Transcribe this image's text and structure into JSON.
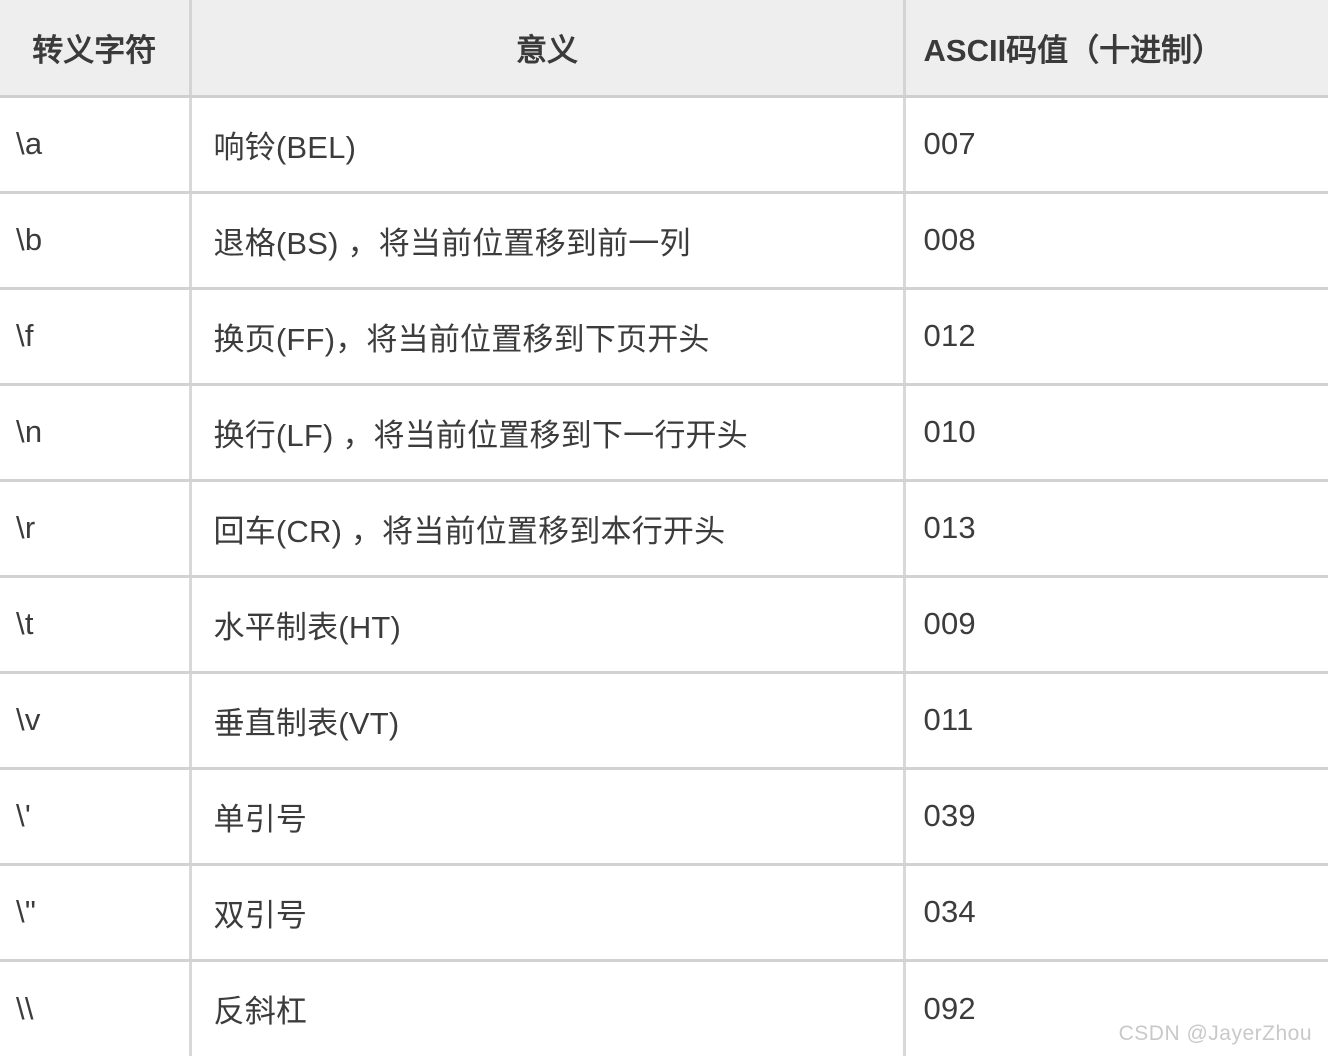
{
  "table": {
    "columns": [
      "转义字符",
      "意义",
      "ASCII码值（十进制）"
    ],
    "rows": [
      {
        "escape": "\\a",
        "meaning": "响铃(BEL)",
        "ascii": "007"
      },
      {
        "escape": "\\b",
        "meaning": "退格(BS) ，将当前位置移到前一列",
        "ascii": "008"
      },
      {
        "escape": "\\f",
        "meaning": "换页(FF)，将当前位置移到下页开头",
        "ascii": "012"
      },
      {
        "escape": "\\n",
        "meaning": "换行(LF) ，将当前位置移到下一行开头",
        "ascii": "010"
      },
      {
        "escape": "\\r",
        "meaning": "回车(CR) ，将当前位置移到本行开头",
        "ascii": "013"
      },
      {
        "escape": "\\t",
        "meaning": "水平制表(HT)",
        "ascii": "009"
      },
      {
        "escape": "\\v",
        "meaning": "垂直制表(VT)",
        "ascii": "011"
      },
      {
        "escape": "\\'",
        "meaning": "单引号",
        "ascii": "039"
      },
      {
        "escape": "\\\"",
        "meaning": "双引号",
        "ascii": "034"
      },
      {
        "escape": "\\\\",
        "meaning": "反斜杠",
        "ascii": "092"
      }
    ]
  },
  "watermark": {
    "text": "CSDN @JayerZhou"
  },
  "colors": {
    "header_background": "#eeeeee",
    "header_text": "#3a3a3a",
    "cell_text": "#3c3c3c",
    "border": "#d4d4d4",
    "cell_background": "#ffffff",
    "watermark_text": "#c9c9c9"
  }
}
